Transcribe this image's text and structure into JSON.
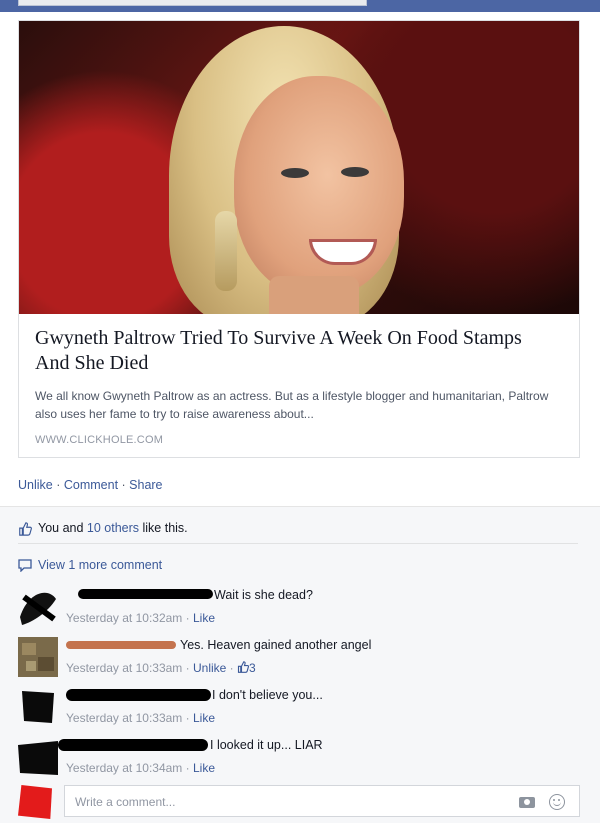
{
  "post": {
    "link": {
      "title": "Gwyneth Paltrow Tried To Survive A Week On Food Stamps And She Died",
      "description": "We all know Gwyneth Paltrow as an actress. But as a lifestyle blogger and humanitarian, Paltrow also uses her fame to try to raise awareness about...",
      "domain": "WWW.CLICKHOLE.COM"
    },
    "actions": {
      "unlike": "Unlike",
      "comment": "Comment",
      "share": "Share",
      "separator": " · "
    }
  },
  "likes": {
    "you": "You and ",
    "others": "10 others",
    "suffix": " like this."
  },
  "view_more": "View 1 more comment",
  "comments": [
    {
      "text": "Wait is she dead?",
      "time": "Yesterday at 10:32am",
      "like": "Like"
    },
    {
      "text": "Yes. Heaven gained another angel",
      "time": "Yesterday at 10:33am",
      "like": "Unlike",
      "like_count": "3"
    },
    {
      "text": "I don't believe you...",
      "time": "Yesterday at 10:33am",
      "like": "Like"
    },
    {
      "text": "I looked it up... LIAR",
      "time": "Yesterday at 10:34am",
      "like": "Like"
    }
  ],
  "reply": {
    "placeholder": "Write a comment..."
  },
  "icons": {
    "like": "thumbs-up-icon",
    "comment": "speech-bubble-icon",
    "camera": "camera-icon",
    "emoji": "smiley-icon"
  },
  "colors": {
    "link": "#3b5998",
    "meta": "#9197a3",
    "feedback_bg": "#f6f7f9"
  }
}
